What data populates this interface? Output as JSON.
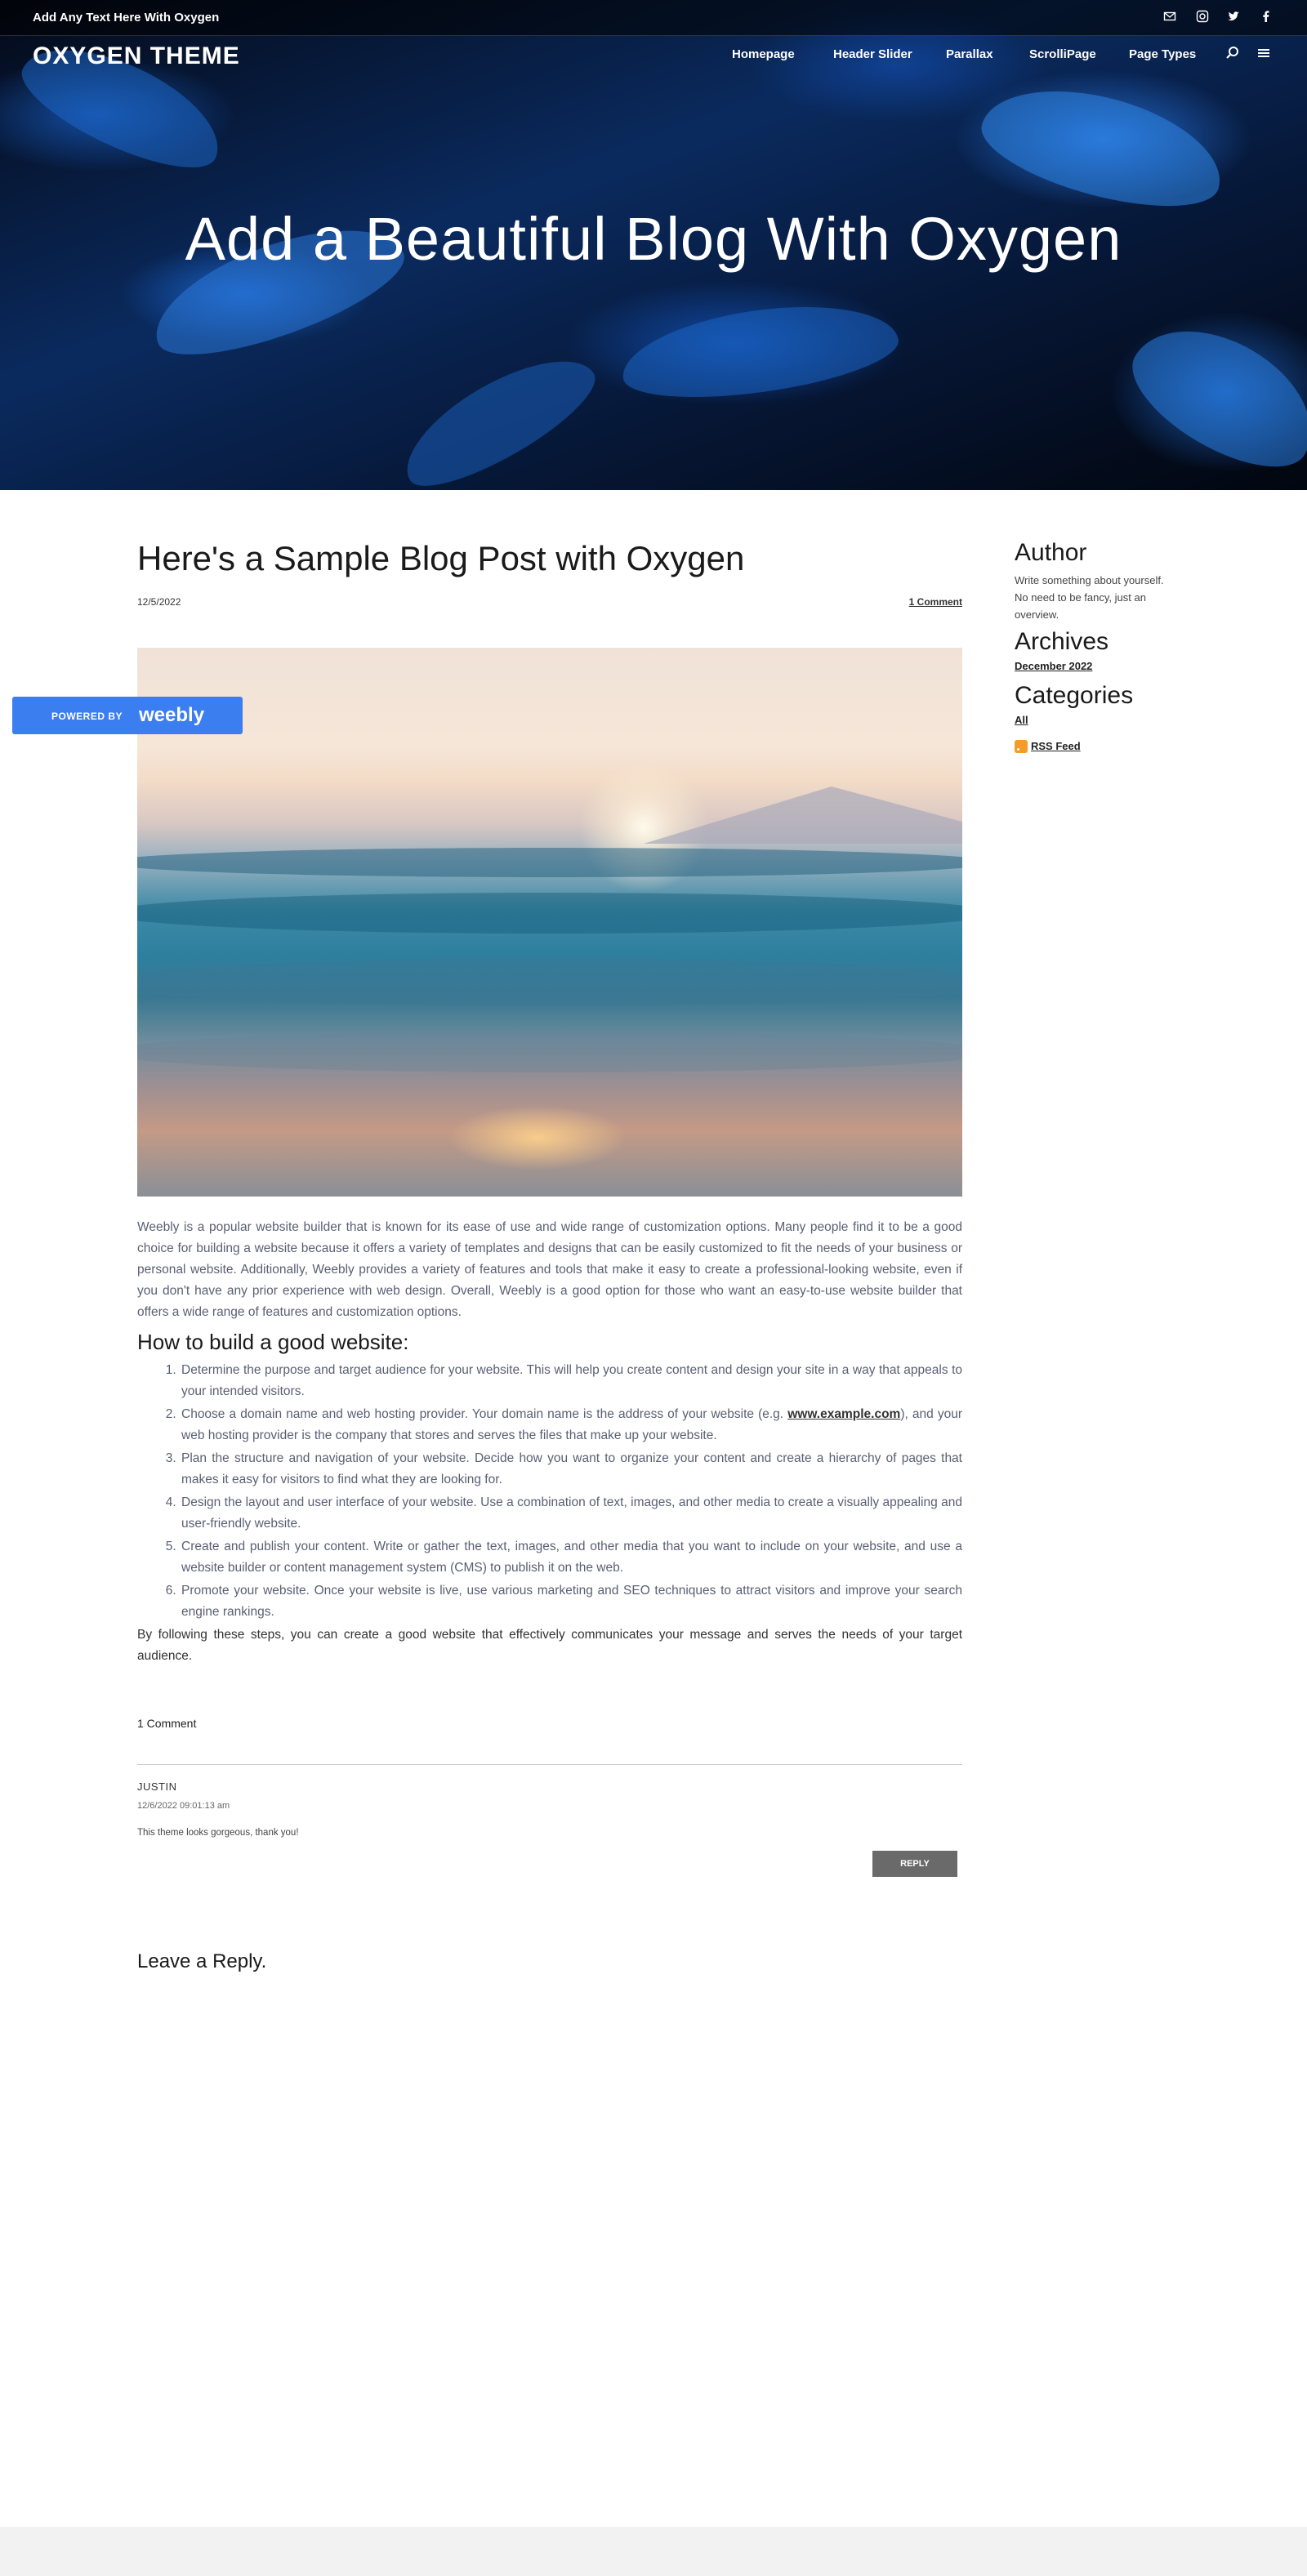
{
  "topbar": {
    "text": "Add Any Text Here With Oxygen"
  },
  "social_icons": [
    "mail-icon",
    "instagram-icon",
    "twitter-icon",
    "facebook-icon"
  ],
  "site_title": "OXYGEN THEME",
  "nav": {
    "items": [
      "Homepage",
      "Header Slider",
      "Parallax",
      "ScrolliPage",
      "Page Types"
    ],
    "icons": [
      "search-icon",
      "menu-icon"
    ]
  },
  "hero": {
    "title": "Add a Beautiful Blog With Oxygen"
  },
  "post": {
    "title": "Here's a Sample Blog Post with Oxygen",
    "date": "12/5/2022",
    "comment_count": "1 Comment",
    "intro": "Weebly is a popular website builder that is known for its ease of use and wide range of customization options. Many people find it to be a good choice for building a website because it offers a variety of templates and designs that can be easily customized to fit the needs of your business or personal website. Additionally, Weebly provides a variety of features and tools that make it easy to create a professional-looking website, even if you don't have any prior experience with web design. Overall, Weebly is a good option for those who want an easy-to-use website builder that offers a wide range of features and customization options.",
    "subheading": "How to build a good website:",
    "steps": [
      "Determine the purpose and target audience for your website. This will help you create content and design your site in a way that appeals to your intended visitors.",
      {
        "before": "Choose a domain name and web hosting provider. Your domain name is the address of your website (e.g. ",
        "link": "www.example.com",
        "after": "), and your web hosting provider is the company that stores and serves the files that make up your website."
      },
      "Plan the structure and navigation of your website. Decide how you want to organize your content and create a hierarchy of pages that makes it easy for visitors to find what they are looking for.",
      "Design the layout and user interface of your website. Use a combination of text, images, and other media to create a visually appealing and user-friendly website.",
      "Create and publish your content. Write or gather the text, images, and other media that you want to include on your website, and use a website builder or content management system (CMS) to publish it on the web.",
      "Promote your website. Once your website is live, use various marketing and SEO techniques to attract visitors and improve your search engine rankings."
    ],
    "closing": "By following these steps, you can create a good website that effectively communicates your message and serves the needs of your target audience."
  },
  "comments": {
    "heading": "1 Comment",
    "items": [
      {
        "author": "JUSTIN",
        "time": "12/6/2022 09:01:13 am",
        "body": "This theme looks gorgeous, thank you!",
        "reply_label": "REPLY"
      }
    ],
    "leave_reply": "Leave a Reply."
  },
  "sidebar": {
    "author_title": "Author",
    "author_text": "Write something about yourself. No need to be fancy, just an overview.",
    "archives_title": "Archives",
    "archives": [
      "December 2022"
    ],
    "categories_title": "Categories",
    "categories": [
      "All"
    ],
    "rss_label": "RSS Feed"
  },
  "badge": {
    "prefix": "POWERED BY",
    "brand": "weebly"
  },
  "colors": {
    "accent": "#3b7ef0",
    "reply_button": "#6a6a6a",
    "body_text": "#5a5f73"
  }
}
